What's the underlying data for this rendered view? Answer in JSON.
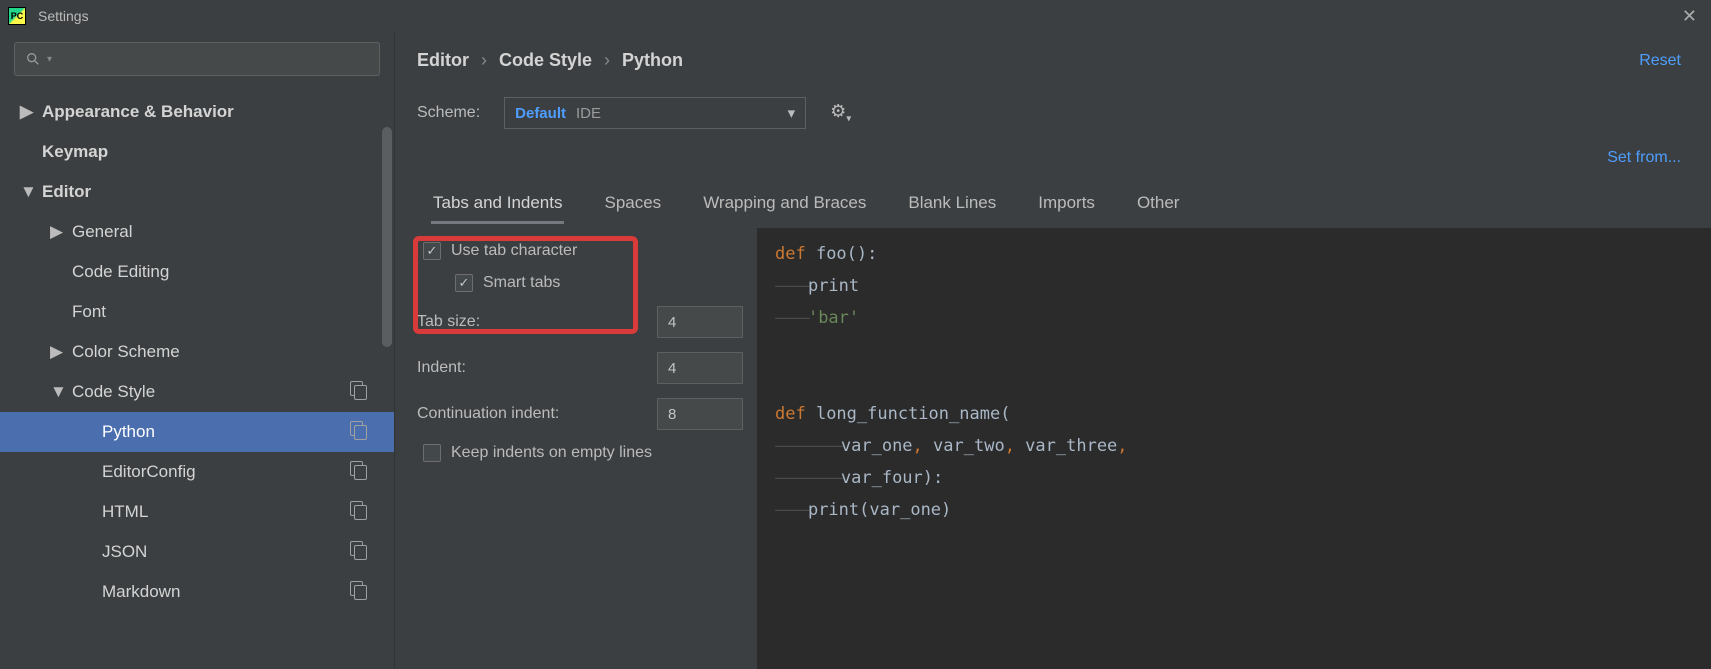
{
  "window": {
    "title": "Settings"
  },
  "sidebar": {
    "search_placeholder": "",
    "items": [
      {
        "label": "Appearance & Behavior",
        "depth": 1,
        "expandable": true,
        "expanded": false
      },
      {
        "label": "Keymap",
        "depth": 1,
        "expandable": false
      },
      {
        "label": "Editor",
        "depth": 1,
        "expandable": true,
        "expanded": true
      },
      {
        "label": "General",
        "depth": 2,
        "expandable": true,
        "expanded": false
      },
      {
        "label": "Code Editing",
        "depth": 2,
        "expandable": false
      },
      {
        "label": "Font",
        "depth": 2,
        "expandable": false
      },
      {
        "label": "Color Scheme",
        "depth": 2,
        "expandable": true,
        "expanded": false
      },
      {
        "label": "Code Style",
        "depth": 2,
        "expandable": true,
        "expanded": true,
        "scheme_icon": true
      },
      {
        "label": "Python",
        "depth": 3,
        "expandable": false,
        "selected": true,
        "scheme_icon": true
      },
      {
        "label": "EditorConfig",
        "depth": 3,
        "expandable": false,
        "scheme_icon": true
      },
      {
        "label": "HTML",
        "depth": 3,
        "expandable": false,
        "scheme_icon": true
      },
      {
        "label": "JSON",
        "depth": 3,
        "expandable": false,
        "scheme_icon": true
      },
      {
        "label": "Markdown",
        "depth": 3,
        "expandable": false,
        "scheme_icon": true
      }
    ]
  },
  "breadcrumb": {
    "parts": [
      "Editor",
      "Code Style",
      "Python"
    ]
  },
  "reset_label": "Reset",
  "scheme": {
    "label": "Scheme:",
    "selected_name": "Default",
    "selected_scope": "IDE"
  },
  "set_from_label": "Set from...",
  "tabs": [
    {
      "label": "Tabs and Indents",
      "active": true
    },
    {
      "label": "Spaces"
    },
    {
      "label": "Wrapping and Braces"
    },
    {
      "label": "Blank Lines"
    },
    {
      "label": "Imports"
    },
    {
      "label": "Other"
    }
  ],
  "form": {
    "use_tab_character": {
      "label": "Use tab character",
      "checked": true
    },
    "smart_tabs": {
      "label": "Smart tabs",
      "checked": true
    },
    "tab_size": {
      "label": "Tab size:",
      "value": "4"
    },
    "indent": {
      "label": "Indent:",
      "value": "4"
    },
    "continuation_indent": {
      "label": "Continuation indent:",
      "value": "8"
    },
    "keep_indents": {
      "label": "Keep indents on empty lines",
      "checked": false
    }
  },
  "preview": {
    "lines": [
      {
        "tokens": [
          {
            "t": "def ",
            "c": "kw"
          },
          {
            "t": "foo",
            "c": "fn"
          },
          {
            "t": "():",
            "c": "punct"
          }
        ]
      },
      {
        "tokens": [
          {
            "t": "————",
            "c": "ws"
          },
          {
            "t": "print",
            "c": "ident"
          }
        ]
      },
      {
        "tokens": [
          {
            "t": "————",
            "c": "ws"
          },
          {
            "t": "'bar'",
            "c": "str"
          }
        ]
      },
      {
        "tokens": []
      },
      {
        "tokens": []
      },
      {
        "tokens": [
          {
            "t": "def ",
            "c": "kw"
          },
          {
            "t": "long_function_name",
            "c": "fn"
          },
          {
            "t": "(",
            "c": "punct"
          }
        ]
      },
      {
        "tokens": [
          {
            "t": "————————",
            "c": "ws"
          },
          {
            "t": "var_one",
            "c": "ident"
          },
          {
            "t": ", ",
            "c": "comma"
          },
          {
            "t": "var_two",
            "c": "ident"
          },
          {
            "t": ", ",
            "c": "comma"
          },
          {
            "t": "var_three",
            "c": "ident"
          },
          {
            "t": ",",
            "c": "comma"
          }
        ]
      },
      {
        "tokens": [
          {
            "t": "————————",
            "c": "ws"
          },
          {
            "t": "var_four",
            "c": "ident"
          },
          {
            "t": "):",
            "c": "punct"
          }
        ]
      },
      {
        "tokens": [
          {
            "t": "————",
            "c": "ws"
          },
          {
            "t": "print",
            "c": "ident"
          },
          {
            "t": "(",
            "c": "punct"
          },
          {
            "t": "var_one",
            "c": "ident"
          },
          {
            "t": ")",
            "c": "punct"
          }
        ]
      }
    ]
  }
}
